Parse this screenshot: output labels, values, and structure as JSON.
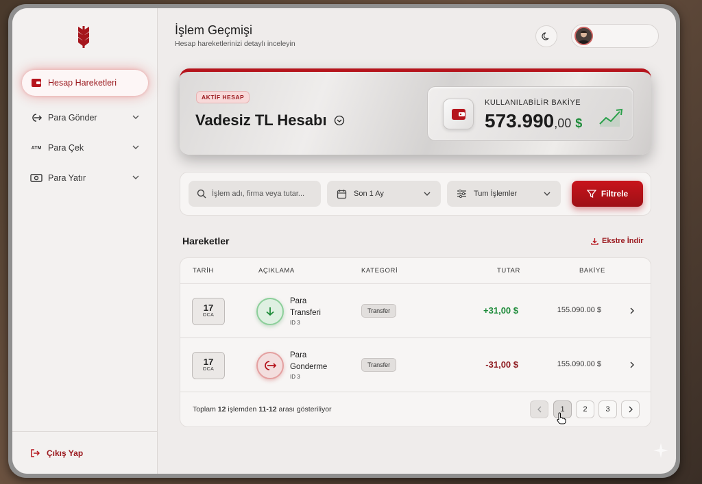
{
  "header": {
    "title": "İşlem Geçmişi",
    "subtitle": "Hesap hareketlerinizi detaylı inceleyin"
  },
  "sidebar": {
    "items": [
      {
        "label": "Hesap Hareketleri",
        "icon": "wallet-icon",
        "active": true
      },
      {
        "label": "Para Gönder",
        "icon": "send-money-icon",
        "active": false
      },
      {
        "label": "Para Çek",
        "icon": "atm-icon",
        "active": false
      },
      {
        "label": "Para Yatır",
        "icon": "cash-icon",
        "active": false
      }
    ],
    "atm_text": "ATM",
    "logout_label": "Çıkış Yap"
  },
  "account": {
    "badge": "AKTİF HESAP",
    "name": "Vadesiz TL Hesabı",
    "balance_label": "KULLANILABİLİR BAKİYE",
    "balance_integer": "573.990",
    "balance_decimal": ",00",
    "currency": "$"
  },
  "filters": {
    "search_placeholder": "İşlem adı, firma veya tutar...",
    "period": "Son 1 Ay",
    "type": "Tum İşlemler",
    "filter_button": "Filtrele"
  },
  "transactions": {
    "section_title": "Hareketler",
    "export_label": "Ekstre İndir",
    "columns": [
      "TARİH",
      "AÇIKLAMA",
      "KATEGORİ",
      "TUTAR",
      "BAKİYE"
    ],
    "rows": [
      {
        "day": "17",
        "month": "OCA",
        "name": "Para Transferi",
        "id": "ID 3",
        "category": "Transfer",
        "amount": "+31,00 $",
        "balance": "155.090.00 $",
        "direction": "in"
      },
      {
        "day": "17",
        "month": "OCA",
        "name": "Para Gonderme",
        "id": "ID 3",
        "category": "Transfer",
        "amount": "-31,00 $",
        "balance": "155.090.00 $",
        "direction": "out"
      }
    ],
    "footer": {
      "prefix": "Toplam ",
      "total": "12",
      "middle": " işlemden ",
      "range": "11-12",
      "suffix": " arası gösteriliyor"
    },
    "pages": [
      "1",
      "2",
      "3"
    ],
    "current_page": "1"
  },
  "colors": {
    "accent": "#b5141c",
    "positive": "#1e8b3a",
    "negative": "#8e1a1f"
  }
}
